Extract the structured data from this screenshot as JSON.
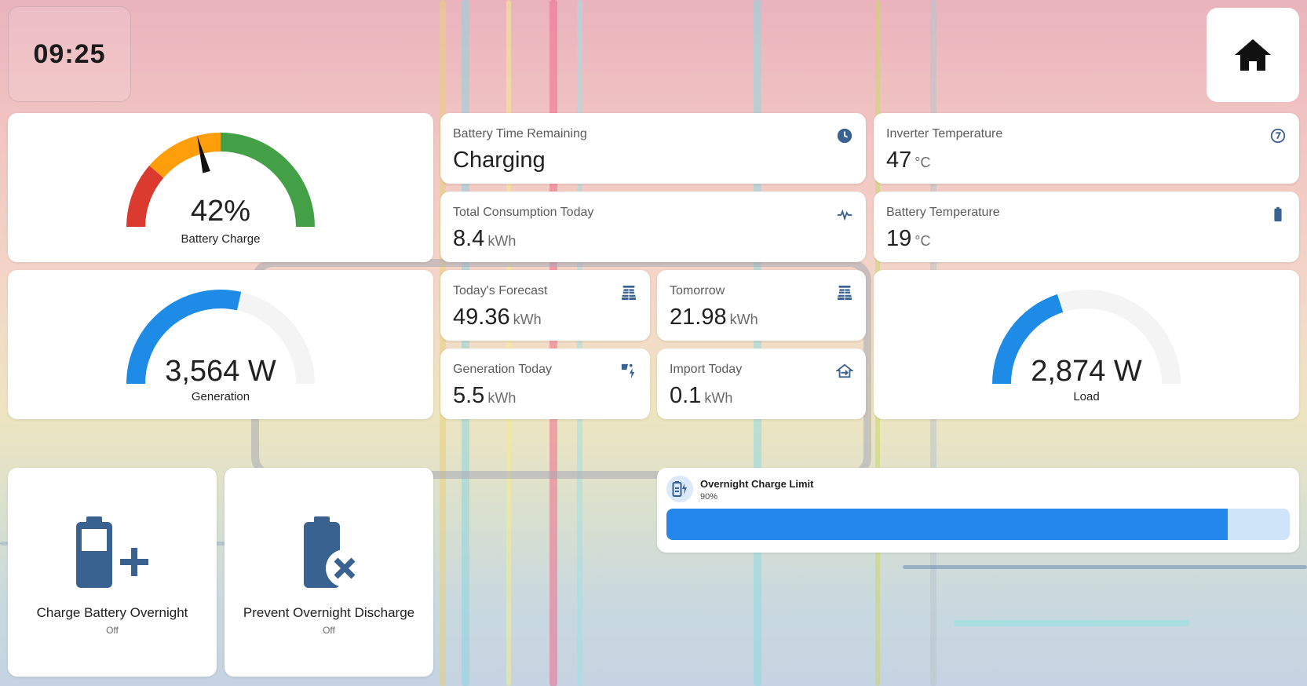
{
  "clock": {
    "time": "09:25"
  },
  "home": {
    "icon": "home-icon"
  },
  "battery_charge": {
    "value": "42%",
    "label": "Battery Charge",
    "percent": 42
  },
  "generation": {
    "value": "3,564 W",
    "label": "Generation",
    "fraction": 0.57
  },
  "load": {
    "value": "2,874 W",
    "label": "Load",
    "fraction": 0.4
  },
  "battery_time": {
    "name": "Battery Time Remaining",
    "value": "Charging",
    "icon": "clock-icon"
  },
  "total_consumption": {
    "name": "Total Consumption Today",
    "value": "8.4",
    "unit": "kWh",
    "icon": "pulse-icon"
  },
  "todays_forecast": {
    "name": "Today's Forecast",
    "value": "49.36",
    "unit": "kWh",
    "icon": "solar-panel-icon"
  },
  "tomorrow": {
    "name": "Tomorrow",
    "value": "21.98",
    "unit": "kWh",
    "icon": "solar-panel-icon"
  },
  "generation_today": {
    "name": "Generation Today",
    "value": "5.5",
    "unit": "kWh",
    "icon": "solar-power-icon"
  },
  "import_today": {
    "name": "Import Today",
    "value": "0.1",
    "unit": "kWh",
    "icon": "home-import-icon"
  },
  "inverter_temp": {
    "name": "Inverter Temperature",
    "value": "47",
    "unit": "°C",
    "icon": "thermometer-icon"
  },
  "battery_temp": {
    "name": "Battery Temperature",
    "value": "19",
    "unit": "°C",
    "icon": "battery-icon"
  },
  "switch_charge": {
    "name": "Charge Battery Overnight",
    "state": "Off",
    "icon": "battery-plus-icon"
  },
  "switch_prevent": {
    "name": "Prevent Overnight Discharge",
    "state": "Off",
    "icon": "battery-remove-icon"
  },
  "charge_limit": {
    "name": "Overnight Charge Limit",
    "value": "90%",
    "fraction": 0.9,
    "icon": "battery-charging-icon"
  },
  "colors": {
    "red": "#db3a2f",
    "orange": "#ff9e0b",
    "green": "#43a047",
    "blue": "#1e8ce6",
    "icon_blue": "#3a6290"
  }
}
